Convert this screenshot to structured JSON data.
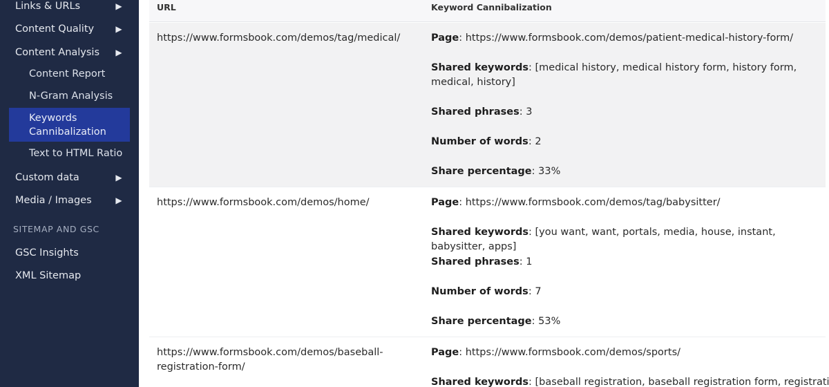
{
  "sidebar": {
    "items": [
      {
        "label": "Links & URLs",
        "has_arrow": true
      },
      {
        "label": "Content Quality",
        "has_arrow": true
      },
      {
        "label": "Content Analysis",
        "has_arrow": true
      },
      {
        "label": "Custom data",
        "has_arrow": true
      },
      {
        "label": "Media / Images",
        "has_arrow": true
      }
    ],
    "subitems": [
      {
        "label": "Content Report"
      },
      {
        "label": "N-Gram Analysis"
      },
      {
        "label": "Keywords Cannibalization",
        "active": true
      },
      {
        "label": "Text to HTML Ratio"
      }
    ],
    "section_heading": "SITEMAP AND GSC",
    "section_items": [
      {
        "label": "GSC Insights"
      },
      {
        "label": "XML Sitemap"
      }
    ],
    "arrow_glyph": "▶"
  },
  "table": {
    "headers": {
      "url": "URL",
      "kc": "Keyword Cannibalization"
    },
    "field_labels": {
      "page": "Page",
      "shared_keywords": "Shared keywords",
      "shared_phrases": "Shared phrases",
      "number_of_words": "Number of words",
      "share_percentage": "Share percentage"
    },
    "rows": [
      {
        "url": "https://www.formsbook.com/demos/tag/medical/",
        "page": ": https://www.formsbook.com/demos/patient-medical-history-form/",
        "shared_keywords": ": [medical history, medical history form, history form, medical, history]",
        "shared_phrases": ": 3",
        "number_of_words": ": 2",
        "share_percentage": ": 33%"
      },
      {
        "url": "https://www.formsbook.com/demos/home/",
        "page": ": https://www.formsbook.com/demos/tag/babysitter/",
        "shared_keywords": ": [you want, want, portals, media, house, instant, babysitter, apps]",
        "shared_phrases": ": 1",
        "number_of_words": ": 7",
        "share_percentage": ": 53%"
      },
      {
        "url": "https://www.formsbook.com/demos/baseball-registration-form/",
        "page": ": https://www.formsbook.com/demos/sports/",
        "shared_keywords": ": [baseball registration, baseball registration form, registration",
        "shared_phrases": "",
        "number_of_words": "",
        "share_percentage": ""
      }
    ]
  },
  "colors": {
    "sidebar_bg": "#1f2a44",
    "active_bg": "#233a9b",
    "row_shade": "#f2f2f3"
  }
}
